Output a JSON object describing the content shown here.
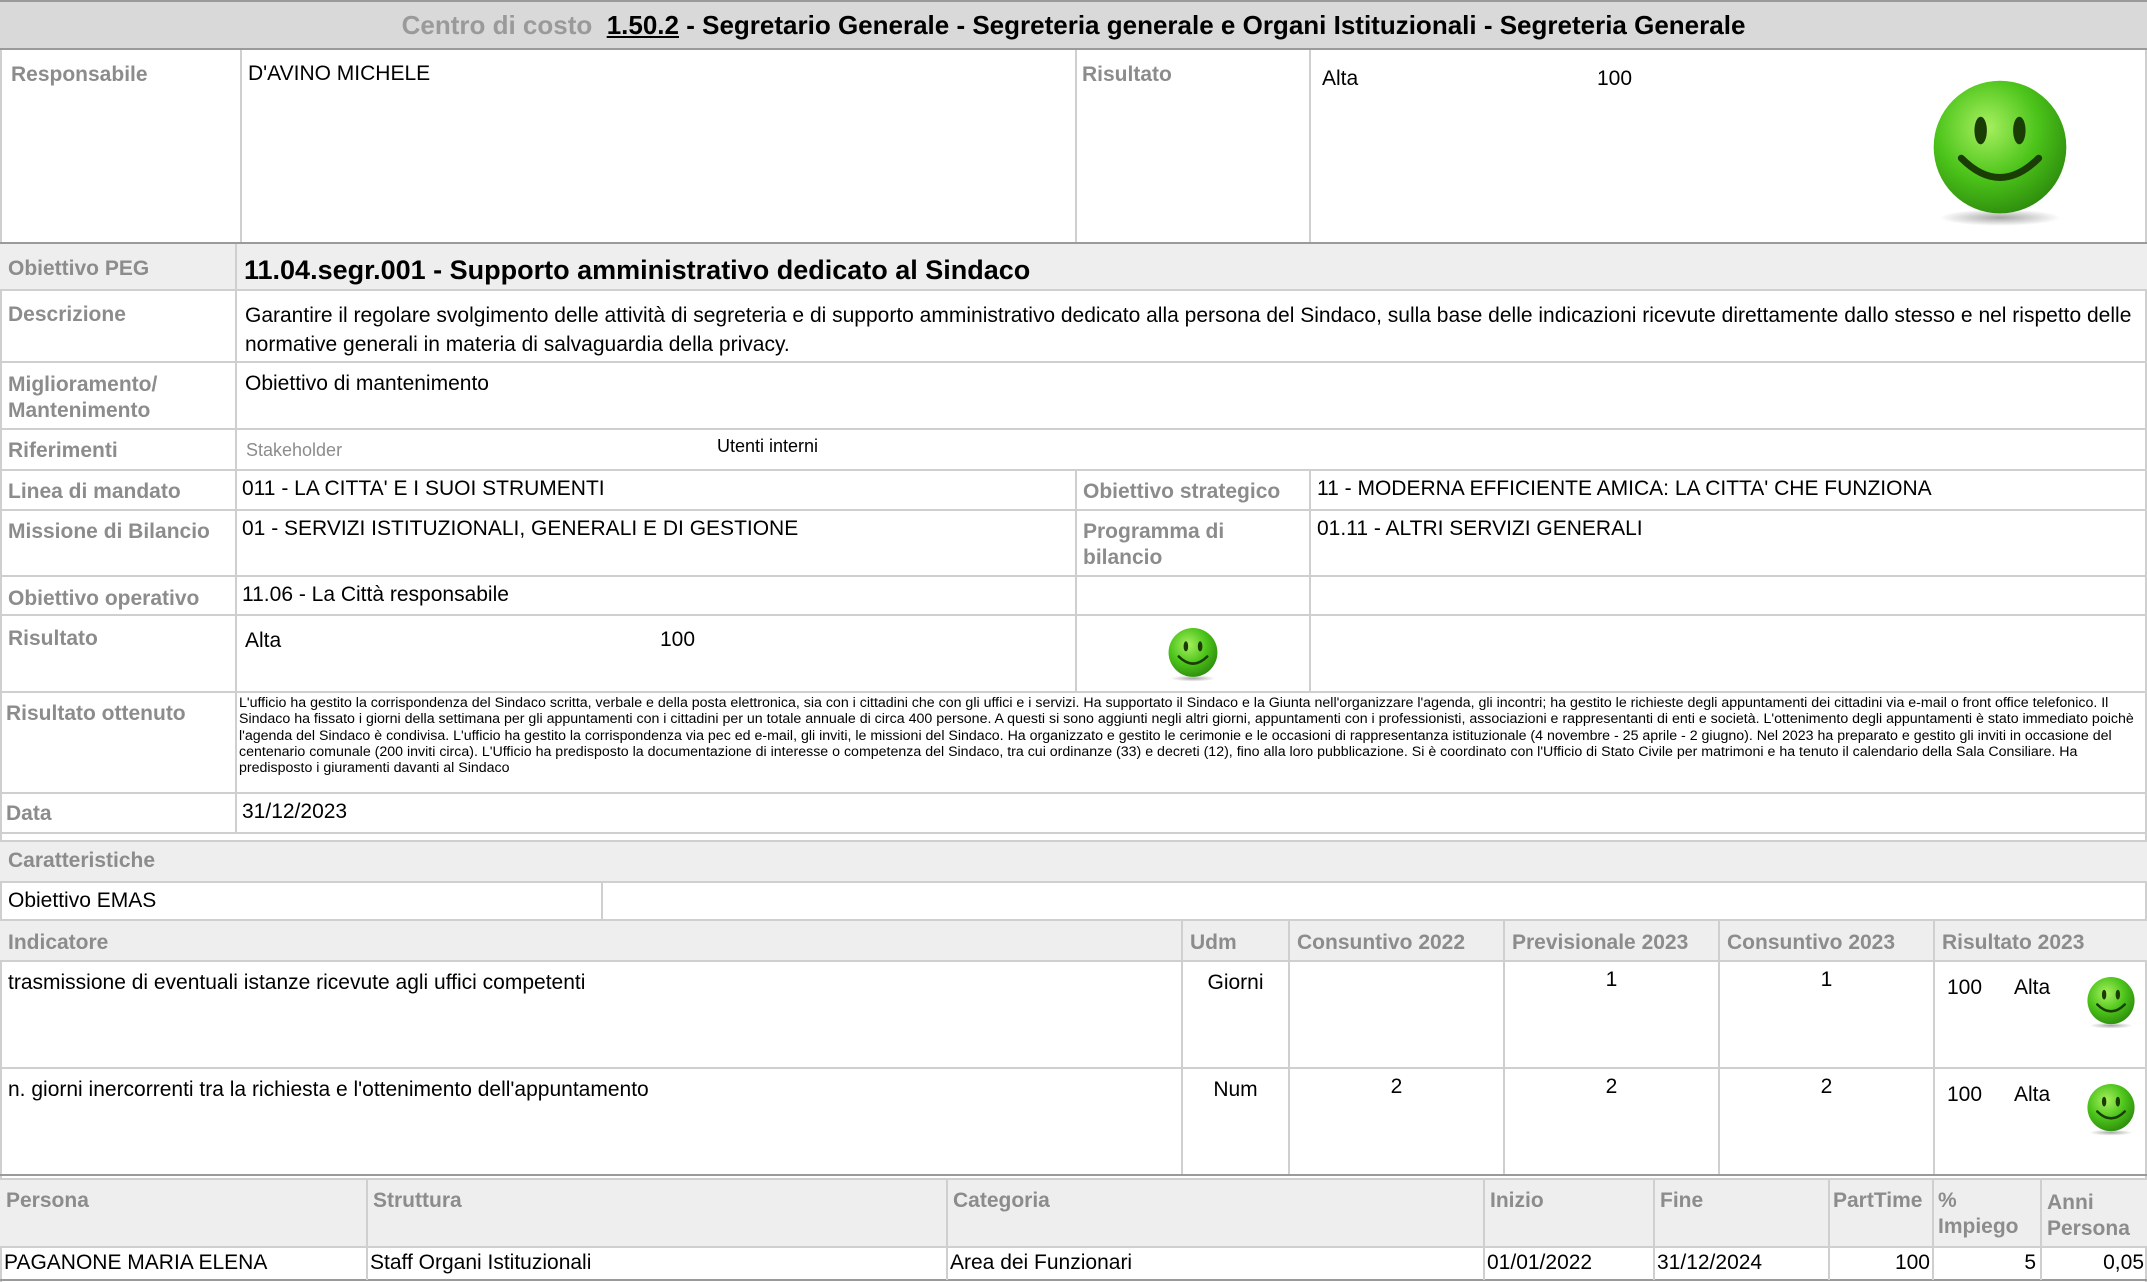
{
  "header": {
    "prefix": "Centro di costo",
    "code": "1.50.2",
    "title_rest": "- Segretario Generale - Segreteria generale e Organi Istituzionali - Segreteria Generale"
  },
  "top": {
    "responsabile_label": "Responsabile",
    "responsabile_value": "D'AVINO MICHELE",
    "risultato_label": "Risultato",
    "risultato_level": "Alta",
    "risultato_value": "100"
  },
  "obiettivo": {
    "peg_label": "Obiettivo PEG",
    "peg_value": "11.04.segr.001 - Supporto amministrativo dedicato al Sindaco",
    "descrizione_label": "Descrizione",
    "descrizione_value": "Garantire il regolare svolgimento delle attività di segreteria e di supporto amministrativo dedicato alla persona del Sindaco, sulla base delle indicazioni ricevute direttamente dallo stesso e nel rispetto delle normative generali in materia di salvaguardia della privacy.",
    "miglioramento_label": "Miglioramento/ Mantenimento",
    "miglioramento_value": "Obiettivo di mantenimento",
    "riferimenti_label": "Riferimenti",
    "stakeholder_label": "Stakeholder",
    "stakeholder_value": "Utenti interni",
    "linea_label": "Linea di mandato",
    "linea_value": "011 - LA CITTA' E I SUOI STRUMENTI",
    "strategico_label": "Obiettivo strategico",
    "strategico_value": "11 - MODERNA EFFICIENTE AMICA: LA CITTA' CHE FUNZIONA",
    "missione_label": "Missione di Bilancio",
    "missione_value": "01 - SERVIZI ISTITUZIONALI, GENERALI E DI GESTIONE",
    "programma_label": "Programma di bilancio",
    "programma_value": "01.11 - ALTRI SERVIZI GENERALI",
    "operativo_label": "Obiettivo operativo",
    "operativo_value": "11.06 - La Città responsabile",
    "risultato_label": "Risultato",
    "risultato_level": "Alta",
    "risultato_value": "100",
    "ottenuto_label": "Risultato ottenuto",
    "ottenuto_value": "L'ufficio ha gestito la corrispondenza del Sindaco scritta, verbale e della posta elettronica, sia con i cittadini che con gli uffici e i servizi. Ha supportato il Sindaco e la Giunta nell'organizzare l'agenda, gli incontri; ha gestito le richieste degli appuntamenti dei cittadini via e-mail o front office telefonico. Il Sindaco ha fissato i giorni della settimana per gli appuntamenti con i cittadini per un totale annuale di circa 400 persone. A questi si sono aggiunti negli altri giorni, appuntamenti con i professionisti, associazioni e rappresentanti di enti e società. L'ottenimento degli appuntamenti è stato immediato poichè l'agenda del Sindaco è condivisa. L'ufficio ha gestito la corrispondenza via pec ed e-mail, gli inviti, le missioni del Sindaco. Ha organizzato e gestito le cerimonie e le occasioni di rappresentanza istituzionale (4 novembre - 25 aprile - 2 giugno). Nel 2023 ha preparato e gestito gli inviti in occasione del centenario comunale (200 inviti circa). L'Ufficio ha predisposto la documentazione di interesse o competenza del Sindaco, tra cui ordinanze (33) e decreti (12), fino alla loro pubblicazione. Si è coordinato con l'Ufficio di Stato Civile per matrimoni e ha tenuto il calendario della Sala Consiliare. Ha predisposto i giuramenti davanti al Sindaco",
    "data_label": "Data",
    "data_value": "31/12/2023"
  },
  "caratteristiche": {
    "label": "Caratteristiche",
    "emas": "Obiettivo EMAS"
  },
  "indicatori": {
    "headers": [
      "Indicatore",
      "Udm",
      "Consuntivo 2022",
      "Previsionale 2023",
      "Consuntivo 2023",
      "Risultato 2023"
    ],
    "rows": [
      {
        "name": "trasmissione di eventuali istanze ricevute agli uffici competenti",
        "udm": "Giorni",
        "cons2022": "",
        "prev2023": "1",
        "cons2023": "1",
        "ris_value": "100",
        "ris_level": "Alta"
      },
      {
        "name": "n. giorni inercorrenti tra la richiesta e l'ottenimento dell'appuntamento",
        "udm": "Num",
        "cons2022": "2",
        "prev2023": "2",
        "cons2023": "2",
        "ris_value": "100",
        "ris_level": "Alta"
      }
    ]
  },
  "persone": {
    "headers": [
      "Persona",
      "Struttura",
      "Categoria",
      "Inizio",
      "Fine",
      "PartTime",
      "% Impiego",
      "Anni Persona"
    ],
    "rows": [
      {
        "persona": "PAGANONE MARIA ELENA",
        "struttura": "Staff Organi Istituzionali",
        "categoria": "Area dei Funzionari",
        "inizio": "01/01/2022",
        "fine": "31/12/2024",
        "parttime": "100",
        "impiego": "5",
        "anni": "0,05"
      }
    ]
  },
  "colors": {
    "label_gray": "#8c8c8c",
    "header_bg": "#d9d9d9",
    "section_bg": "#eeeeee",
    "smiley_green": "#4cc41a"
  }
}
